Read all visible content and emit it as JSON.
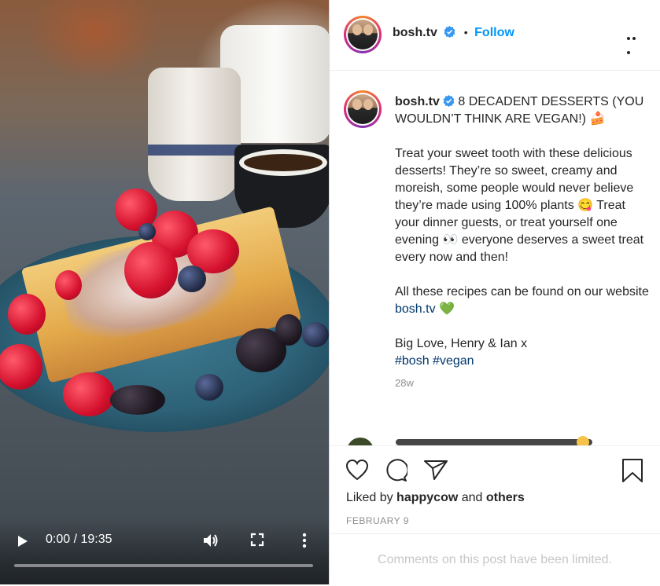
{
  "video": {
    "current_time": "0:00",
    "separator": "/",
    "duration": "19:35",
    "progress": 0
  },
  "post": {
    "username": "bosh.tv",
    "follow_label": "Follow",
    "dot": "•",
    "caption": {
      "username": "bosh.tv",
      "title_text": "8 DECADENT DESSERTS (YOU WOULDN’T THINK ARE VEGAN!) 🍰",
      "para1": "Treat your sweet tooth with these delicious desserts! They’re so sweet, creamy and moreish, some people would never believe they’re made using 100% plants 😋 Treat your dinner guests, or treat yourself one evening 👀 everyone deserves a sweet treat every now and then!",
      "para2_prefix": "All these recipes can be found on our website ",
      "para2_link": "bosh.tv",
      "para2_suffix": " 💚",
      "para3_line": "Big Love, Henry & Ian x",
      "hashtag1": "#bosh",
      "hashtag2": "#vegan",
      "age": "28w"
    },
    "likes": {
      "prefix": "Liked by ",
      "user": "happycow",
      "middle": " and ",
      "others": "others"
    },
    "date": "FEBRUARY 9",
    "comments_limited": "Comments on this post have been limited."
  },
  "colors": {
    "accent": "#0095f6",
    "link": "#00376b",
    "text": "#262626",
    "muted": "#8e8e8e"
  },
  "icons": [
    "play-icon",
    "volume-icon",
    "fullscreen-icon",
    "more-vertical-icon",
    "verified-icon",
    "more-horizontal-icon",
    "heart-icon",
    "comment-icon",
    "share-icon",
    "bookmark-icon"
  ]
}
